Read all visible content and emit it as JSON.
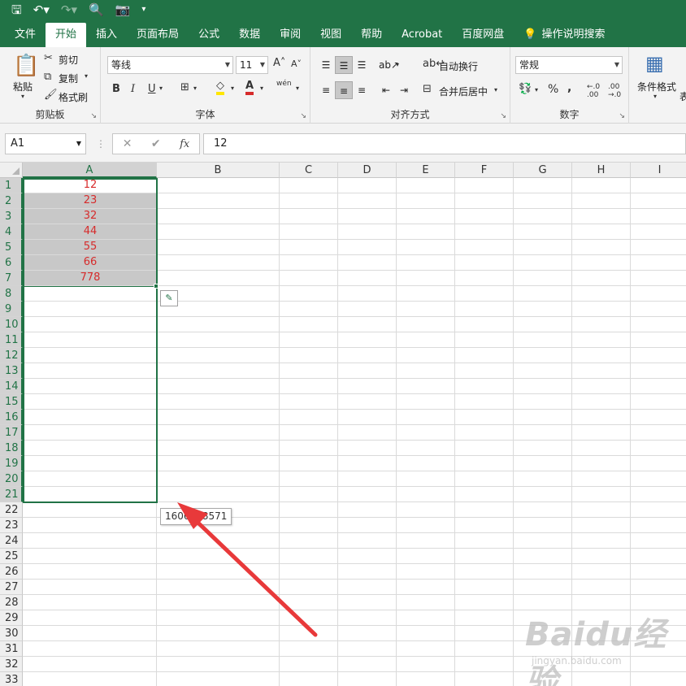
{
  "qat": {
    "save_icon": "save-icon",
    "undo_icon": "undo-icon",
    "redo_icon": "redo-icon",
    "print_preview_icon": "print-preview-icon",
    "camera_icon": "camera-icon",
    "customize_icon": "customize-qat-icon"
  },
  "tabs": [
    "文件",
    "开始",
    "插入",
    "页面布局",
    "公式",
    "数据",
    "审阅",
    "视图",
    "帮助",
    "Acrobat",
    "百度网盘"
  ],
  "active_tab": "开始",
  "tell_me": "操作说明搜索",
  "ribbon": {
    "clipboard": {
      "label": "剪贴板",
      "paste": "粘贴",
      "cut": "剪切",
      "copy": "复制",
      "format_painter": "格式刷"
    },
    "font": {
      "label": "字体",
      "font_name": "等线",
      "font_size": "11",
      "bold": "B",
      "italic": "I",
      "underline": "U",
      "phonetic": "wén"
    },
    "alignment": {
      "label": "对齐方式",
      "wrap_text": "自动换行",
      "merge_center": "合并后居中"
    },
    "number": {
      "label": "数字",
      "format": "常规",
      "percent": "%",
      "comma": ","
    },
    "styles": {
      "conditional_format": "条件格式",
      "partial_next": "表"
    }
  },
  "formula_bar": {
    "name_box": "A1",
    "cancel": "✕",
    "enter": "✔",
    "fx": "fx",
    "value": "12"
  },
  "columns": [
    "A",
    "B",
    "C",
    "D",
    "E",
    "F",
    "G",
    "H",
    "I"
  ],
  "rows": [
    "1",
    "2",
    "3",
    "4",
    "5",
    "6",
    "7",
    "8",
    "9",
    "10",
    "11",
    "12",
    "13",
    "14",
    "15",
    "16",
    "17",
    "18",
    "19",
    "20",
    "21",
    "22",
    "23",
    "24",
    "25",
    "26",
    "27",
    "28",
    "29",
    "30",
    "31",
    "32",
    "33"
  ],
  "cells_a": [
    "12",
    "23",
    "32",
    "44",
    "55",
    "66",
    "778"
  ],
  "tooltip": "1606678571",
  "colors": {
    "accent": "#217346",
    "cell_text": "#d62b2b",
    "selection_fill": "#c8c8c8",
    "arrow": "#e8393a"
  },
  "watermark": {
    "logo": "Baidu经验",
    "url": "jingyan.baidu.com"
  }
}
